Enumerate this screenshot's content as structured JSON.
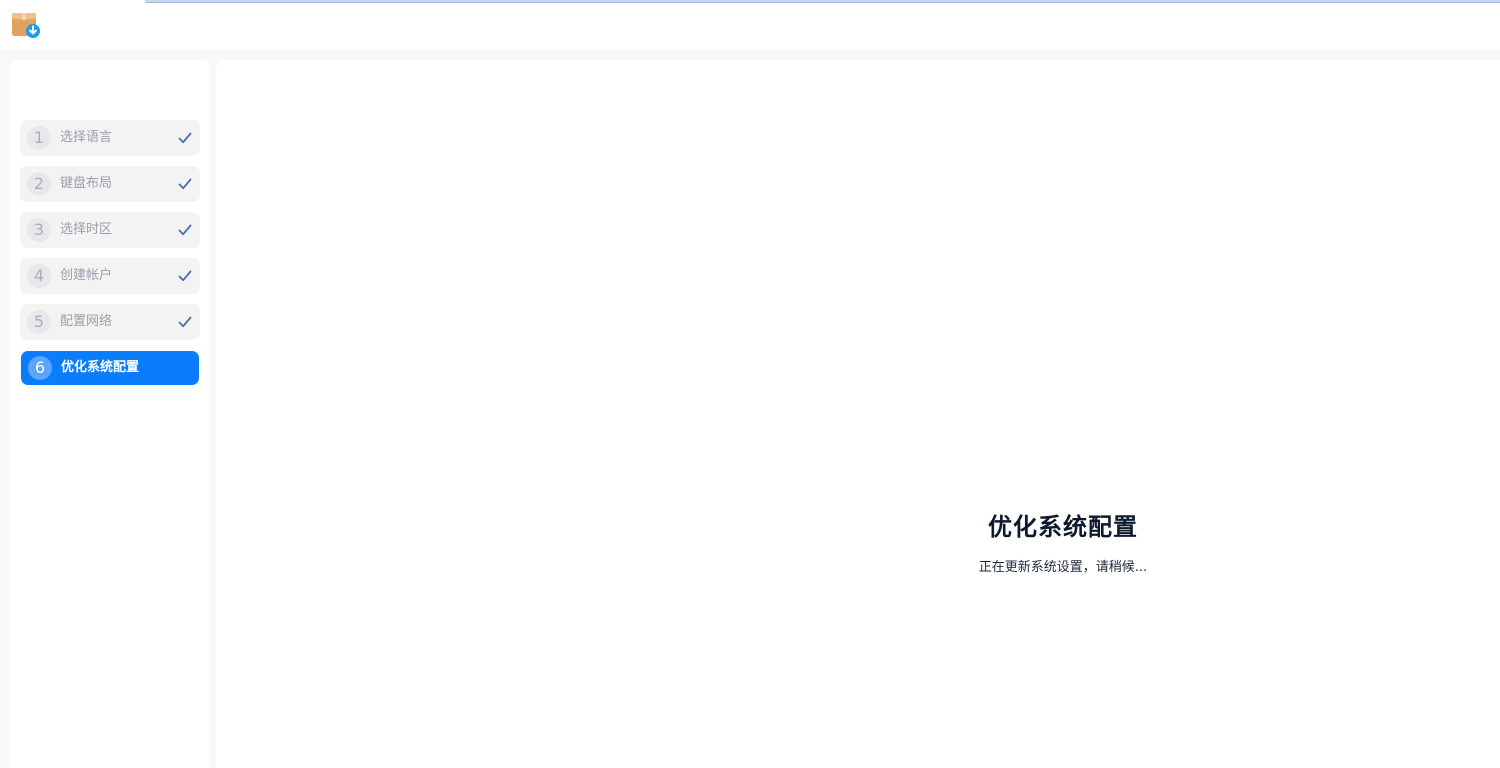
{
  "titlebar": {
    "icon": "installer-package-download-icon"
  },
  "sidebar": {
    "steps": [
      {
        "number": "1",
        "label": "选择语言",
        "state": "done",
        "icon": "check-icon"
      },
      {
        "number": "2",
        "label": "键盘布局",
        "state": "done",
        "icon": "check-icon"
      },
      {
        "number": "3",
        "label": "选择时区",
        "state": "done",
        "icon": "check-icon"
      },
      {
        "number": "4",
        "label": "创建帐户",
        "state": "done",
        "icon": "check-icon"
      },
      {
        "number": "5",
        "label": "配置网络",
        "state": "done",
        "icon": "check-icon"
      },
      {
        "number": "6",
        "label": "优化系统配置",
        "state": "active"
      }
    ]
  },
  "main": {
    "title": "优化系统配置",
    "subtitle": "正在更新系统设置，请稍候..."
  },
  "colors": {
    "accent": "#0a7dfb",
    "check": "#4a6fa8",
    "title_text": "#0d1a2e"
  }
}
